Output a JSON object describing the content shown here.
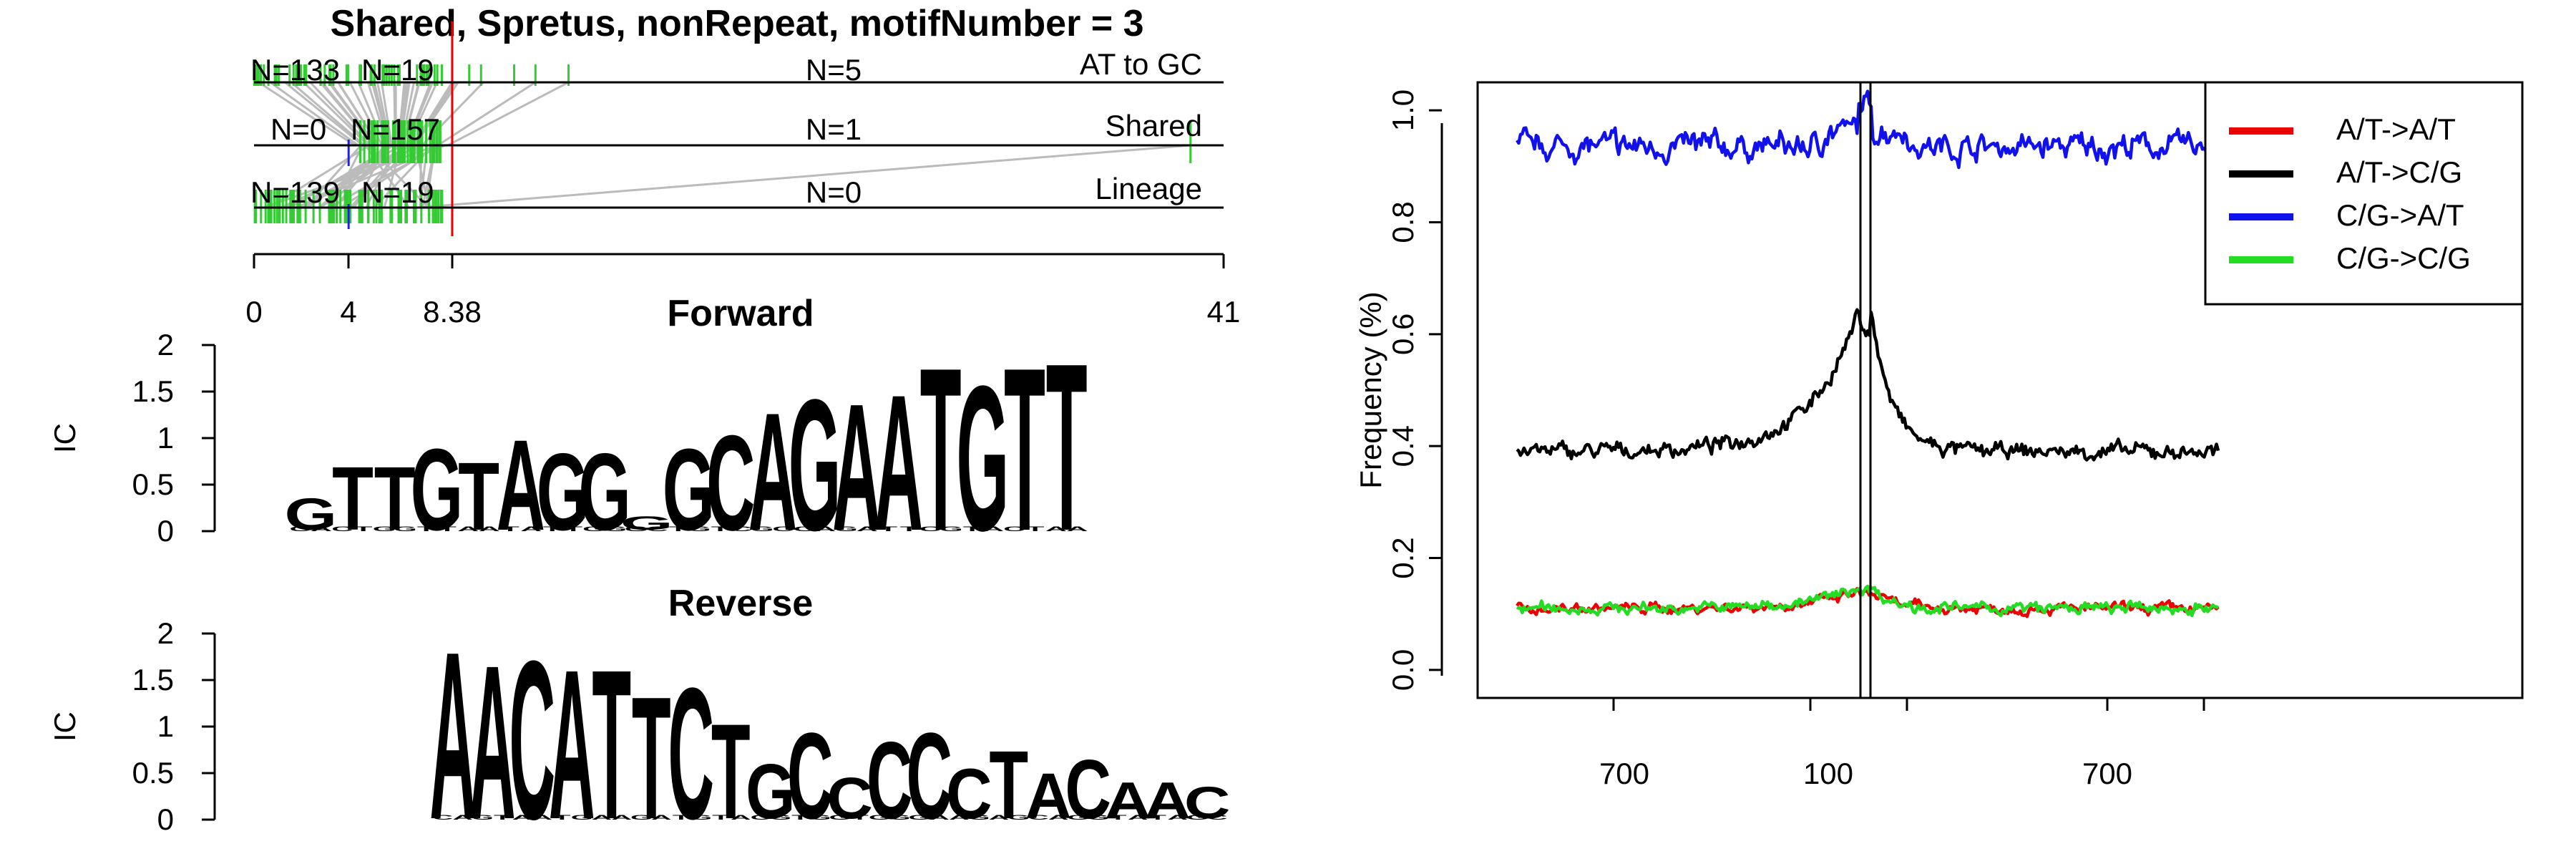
{
  "title": "Shared, Spretus, nonRepeat, motifNumber = 3",
  "colors": {
    "A": "#22dd22",
    "C": "#1111dd",
    "G": "#f2a21b",
    "T": "#ee1111"
  },
  "chart_data": [
    {
      "type": "scatter",
      "title": "Shared, Spretus, nonRepeat, motifNumber = 3",
      "x_ticks": [
        "0",
        "4",
        "8.38",
        "41"
      ],
      "xlim": [
        0,
        41
      ],
      "red_line_at": 8.38,
      "blue_line_at": 4,
      "rows": [
        {
          "name": "AT to GC",
          "n_left": "N=133",
          "n_mid": "N=19",
          "n_right": "N=5"
        },
        {
          "name": "Shared",
          "n_left": "N=0",
          "n_mid": "N=157",
          "n_right": "N=1"
        },
        {
          "name": "Lineage",
          "n_left": "N=139",
          "n_mid": "N=19",
          "n_right": "N=0"
        }
      ]
    },
    {
      "type": "bar",
      "title": "Forward",
      "ylabel": "IC",
      "y_ticks": [
        "2",
        "1.5",
        "1",
        "0.5",
        "0"
      ],
      "ylim": [
        0,
        2
      ],
      "letters": [
        "G",
        "T",
        "T",
        "G",
        "T",
        "A",
        "G",
        "G",
        "G",
        "G",
        "C",
        "A",
        "G",
        "A",
        "A",
        "T",
        "G",
        "T",
        "T"
      ],
      "ic": [
        0.35,
        0.7,
        0.7,
        0.9,
        0.75,
        1.0,
        0.85,
        0.85,
        0.15,
        0.9,
        1.05,
        1.3,
        1.45,
        1.4,
        1.5,
        1.8,
        1.6,
        1.8,
        1.85
      ]
    },
    {
      "type": "bar",
      "title": "Reverse",
      "ylabel": "IC",
      "y_ticks": [
        "2",
        "1.5",
        "1",
        "0.5",
        "0"
      ],
      "ylim": [
        0,
        2
      ],
      "letters": [
        "A",
        "A",
        "C",
        "A",
        "T",
        "T",
        "C",
        "T",
        "G",
        "C",
        "C",
        "C",
        "C",
        "C",
        "T",
        "A",
        "C",
        "A",
        "A",
        "C"
      ],
      "ic": [
        1.85,
        1.7,
        1.75,
        1.65,
        1.65,
        1.35,
        1.45,
        1.05,
        0.6,
        0.95,
        0.45,
        0.85,
        0.95,
        0.55,
        0.75,
        0.5,
        0.65,
        0.4,
        0.4,
        0.35
      ]
    },
    {
      "type": "line",
      "ylabel": "Frequency (%)",
      "y_ticks": [
        "0.0",
        "0.2",
        "0.4",
        "0.6",
        "0.8",
        "1.0"
      ],
      "x_tick_labels": [
        "700",
        "100",
        "700"
      ],
      "ylim": [
        -0.05,
        1.05
      ],
      "legend": "top-right",
      "series": [
        {
          "name": "A/T->A/T",
          "color": "#ee0000",
          "base": 0.11,
          "peak": 0.03,
          "noise": 0.008
        },
        {
          "name": "A/T->C/G",
          "color": "#000000",
          "base": 0.39,
          "peak": 0.26,
          "noise": 0.012
        },
        {
          "name": "C/G->A/T",
          "color": "#1111ee",
          "base": 0.935,
          "peak": 0.0,
          "noise": 0.02
        },
        {
          "name": "C/G->C/G",
          "color": "#22dd22",
          "base": 0.11,
          "peak": 0.04,
          "noise": 0.009
        }
      ]
    }
  ]
}
